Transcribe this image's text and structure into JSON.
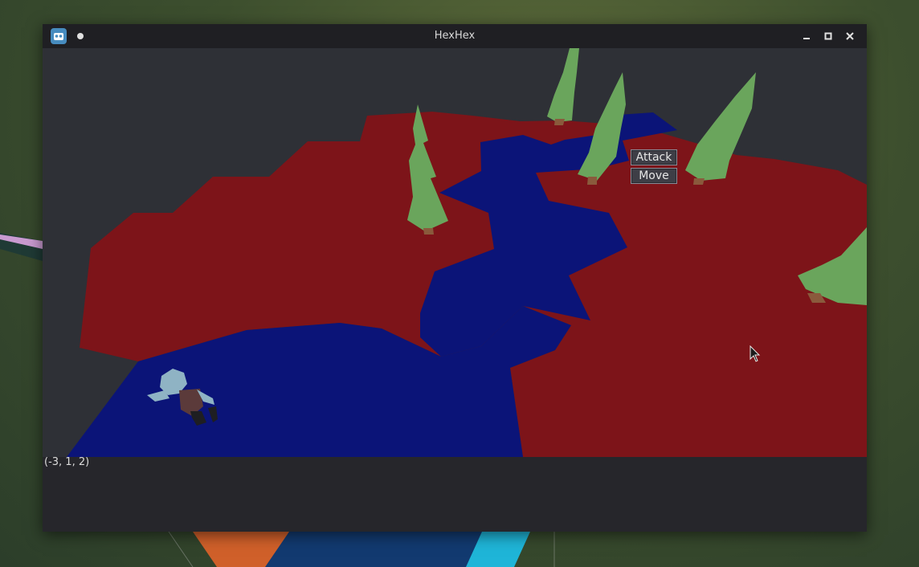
{
  "window": {
    "title": "HexHex"
  },
  "icons": {
    "app": "godot-icon",
    "modified": "dot-icon",
    "minimize": "minimize-icon",
    "maximize": "maximize-icon",
    "close": "close-icon"
  },
  "context_menu": {
    "attack_label": "Attack",
    "move_label": "Move"
  },
  "status": {
    "hovered_coordinate": "(-3, 1, 2)"
  },
  "colors": {
    "land": "#7d1419",
    "water": "#0b1478",
    "tree": "#6aa55c",
    "trunk": "#8a5a3c",
    "void": "#2e3036"
  }
}
